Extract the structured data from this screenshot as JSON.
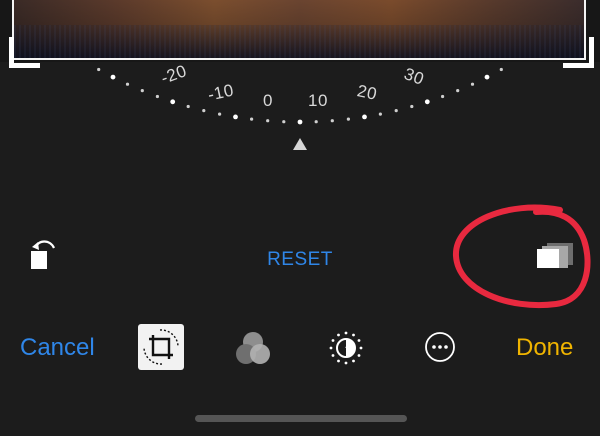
{
  "photo": {
    "description_icon": "photo-preview"
  },
  "dial": {
    "labels": [
      "-20",
      "-10",
      "0",
      "10",
      "20",
      "30"
    ],
    "pointer_icon": "triangle-up-icon"
  },
  "toolbar_top": {
    "rotate_icon": "rotate-left-icon",
    "reset_label": "RESET",
    "aspect_icon": "aspect-ratio-icon"
  },
  "toolbar_bottom": {
    "cancel_label": "Cancel",
    "done_label": "Done",
    "tools": [
      "crop-rotate-icon",
      "filters-icon",
      "adjust-icon",
      "more-icon"
    ]
  },
  "colors": {
    "accent_blue": "#2f86e8",
    "done_yellow": "#f0b400",
    "annotation_red": "#e8293f",
    "background": "#1c1c1c"
  }
}
